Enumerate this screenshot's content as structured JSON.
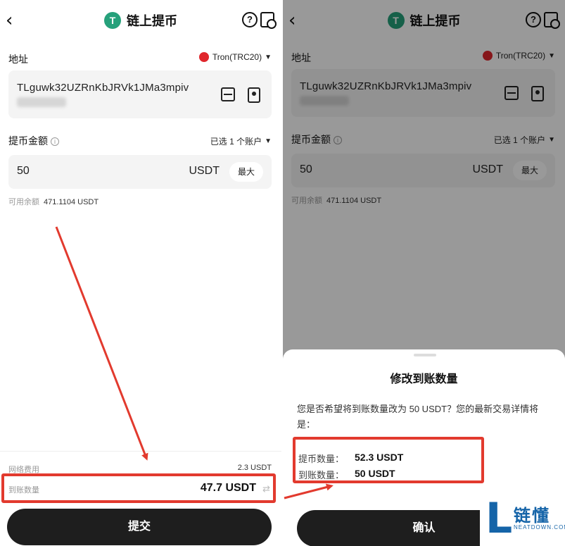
{
  "left": {
    "header": {
      "back": "‹",
      "logo": "T",
      "title": "链上提币",
      "help": "?"
    },
    "address_label": "地址",
    "network": "Tron(TRC20)",
    "address": "TLguwk32UZRnKbJRVk1JMa3mpiv",
    "amount_label": "提币金额",
    "amount_info": "i",
    "account_select": "已选 1 个账户",
    "amount_value": "50",
    "amount_unit": "USDT",
    "max_button": "最大",
    "available_label": "可用余额",
    "available_value": "471.1104 USDT",
    "fee_label": "网络费用",
    "fee_value": "2.3 USDT",
    "receive_label": "到账数量",
    "receive_value": "47.7 USDT",
    "submit_button": "提交"
  },
  "right": {
    "header": {
      "back": "‹",
      "logo": "T",
      "title": "链上提币",
      "help": "?"
    },
    "address_label": "地址",
    "network": "Tron(TRC20)",
    "address": "TLguwk32UZRnKbJRVk1JMa3mpiv",
    "amount_label": "提币金额",
    "amount_info": "i",
    "account_select": "已选 1 个账户",
    "amount_value": "50",
    "amount_unit": "USDT",
    "max_button": "最大",
    "available_label": "可用余额",
    "available_value": "471.1104 USDT",
    "sheet": {
      "title": "修改到账数量",
      "description": "您是否希望将到账数量改为 50 USDT？您的最新交易详情将是：",
      "withdraw_label": "提币数量：",
      "withdraw_value": "52.3 USDT",
      "receive_label": "到账数量：",
      "receive_value": "50 USDT",
      "confirm_button": "确认"
    }
  },
  "watermark": {
    "letter": "L",
    "name": "链懂",
    "domain": "NEATDOWN.COM"
  },
  "colors": {
    "tether": "#26a17b",
    "tron": "#e0262c",
    "highlight": "#e23a2e",
    "button": "#1e1e1e",
    "brand": "#1564a8"
  }
}
